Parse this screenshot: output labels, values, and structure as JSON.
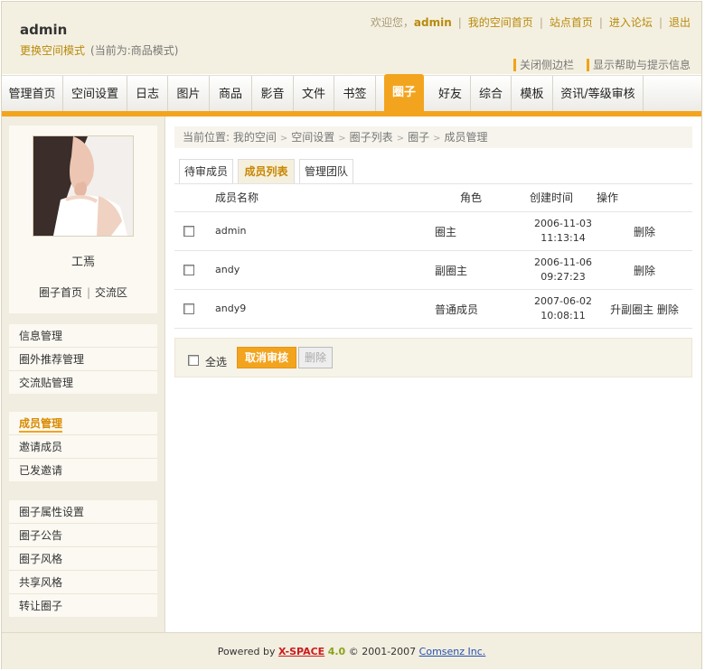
{
  "header": {
    "username": "admin",
    "mode_link": "更换空间模式",
    "mode_current": "(当前为:商品模式)",
    "welcome": "欢迎您，",
    "welcome_user": "admin",
    "links": [
      "我的空间首页",
      "站点首页",
      "进入论坛",
      "退出"
    ],
    "tool_links": [
      "关闭侧边栏",
      "显示帮助与提示信息"
    ]
  },
  "nav": {
    "tabs": [
      "管理首页",
      "空间设置",
      "日志",
      "图片",
      "商品",
      "影音",
      "文件",
      "书签",
      "圈子",
      "好友",
      "综合",
      "模板",
      "资讯/等级审核"
    ],
    "active": "圈子"
  },
  "sidebar": {
    "profile": {
      "name": "工焉",
      "links": [
        "圈子首页",
        "交流区"
      ]
    },
    "menu1": [
      "信息管理",
      "圈外推荐管理",
      "交流贴管理"
    ],
    "menu2": [
      "成员管理",
      "邀请成员",
      "已发邀请"
    ],
    "menu3": [
      "圈子属性设置",
      "圈子公告",
      "圈子风格",
      "共享风格",
      "转让圈子"
    ]
  },
  "breadcrumb": {
    "prefix": "当前位置: ",
    "items": [
      "我的空间",
      "空间设置",
      "圈子列表",
      "圈子",
      "成员管理"
    ]
  },
  "subtabs": [
    "待审成员",
    "成员列表",
    "管理团队"
  ],
  "table": {
    "headers": [
      "成员名称",
      "角色",
      "创建时间",
      "操作"
    ],
    "rows": [
      {
        "name": "admin",
        "role": "圈主",
        "date": "2006-11-03",
        "time": "11:13:14",
        "ops": "删除"
      },
      {
        "name": "andy",
        "role": "副圈主",
        "date": "2006-11-06",
        "time": "09:27:23",
        "ops": "删除"
      },
      {
        "name": "andy9",
        "role": "普通成员",
        "date": "2007-06-02",
        "time": "10:08:11",
        "ops": "升副圈主 删除"
      }
    ]
  },
  "actions": {
    "select_all": "全选",
    "cancel_review": "取消审核",
    "delete": "删除"
  },
  "footer": {
    "powered": "Powered by ",
    "brand": "X-SPACE",
    "version": "4.0",
    "copyright": " © 2001-2007 ",
    "company": "Comsenz Inc."
  },
  "colors": {
    "accent": "#f3a41e",
    "header_bg": "#f4f0e1",
    "link": "#b88a0c"
  }
}
